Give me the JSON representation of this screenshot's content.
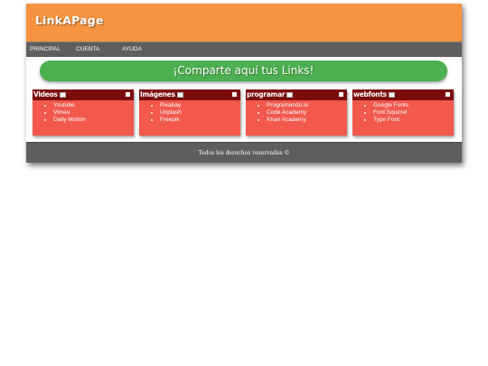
{
  "header": {
    "logo": "LinkAPage"
  },
  "nav": {
    "items": [
      "PRINCIPAL",
      "CUENTA",
      "AYUDA"
    ]
  },
  "banner": {
    "text": "¡Comparte aquí tus Links!"
  },
  "cards": [
    {
      "title": "Videos",
      "links": [
        "Youtube",
        "Vimeo",
        "Daily Motion"
      ]
    },
    {
      "title": "Imágenes",
      "links": [
        "Pixabay",
        "Unplash",
        "Freepik"
      ]
    },
    {
      "title": "programar",
      "links": [
        "Programando.io",
        "Code Academy",
        "Khan Academy"
      ]
    },
    {
      "title": "webfonts",
      "links": [
        "Google Fonts",
        "Font Squirrel",
        "Type Font"
      ]
    }
  ],
  "footer": {
    "text": "Todos los derechos reservados ©"
  },
  "colors": {
    "header": "#f6943f",
    "nav": "#5e5e5e",
    "banner": "#4caf50",
    "card": "#f2584c",
    "card_header": "#7b0c0c"
  }
}
